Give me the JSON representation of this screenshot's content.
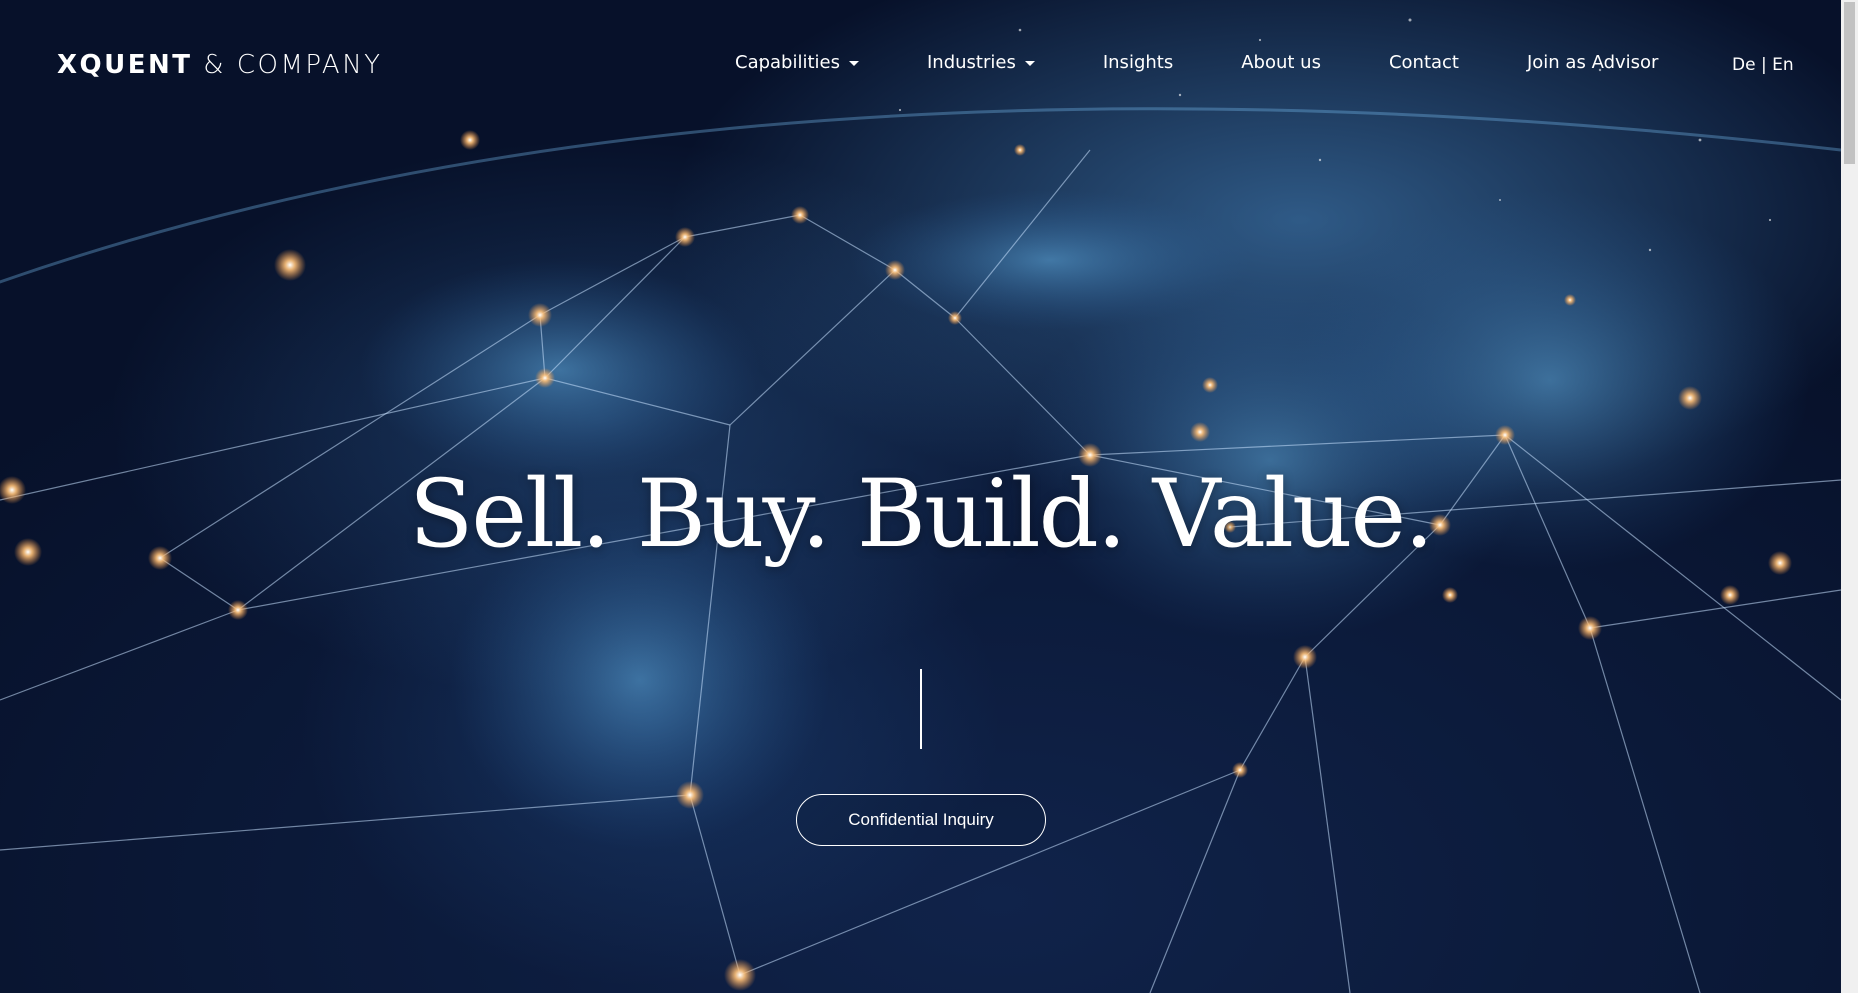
{
  "brand": {
    "logo_strong": "XQUENT",
    "logo_rest": " & COMPANY"
  },
  "nav": {
    "items": [
      {
        "label": "Capabilities",
        "dropdown": true
      },
      {
        "label": "Industries",
        "dropdown": true
      },
      {
        "label": "Insights",
        "dropdown": false
      },
      {
        "label": "About us",
        "dropdown": false
      },
      {
        "label": "Contact",
        "dropdown": false
      },
      {
        "label": "Join as Advisor",
        "dropdown": false
      }
    ],
    "lang": {
      "de": "De",
      "separator": " | ",
      "en": "En"
    }
  },
  "hero": {
    "headline": "Sell. Buy. Build. Value.",
    "cta_label": "Confidential Inquiry"
  },
  "colors": {
    "background": "#0b1730",
    "text": "#ffffff",
    "glow": "#ffb870"
  },
  "icons": {
    "dropdown": "caret-down-icon"
  }
}
